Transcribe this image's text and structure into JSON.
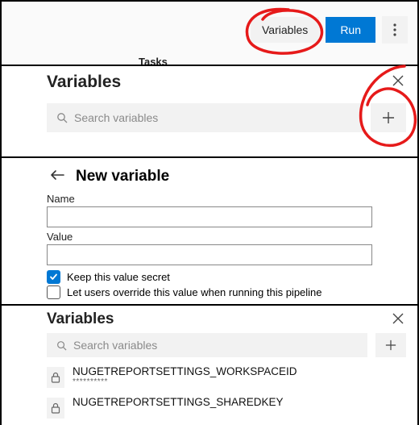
{
  "toolbar": {
    "variables_label": "Variables",
    "run_label": "Run",
    "tasks_hint": "Tasks"
  },
  "panel2": {
    "title": "Variables",
    "search_placeholder": "Search variables"
  },
  "newvar": {
    "title": "New variable",
    "name_label": "Name",
    "value_label": "Value",
    "name_value": "",
    "value_value": "",
    "secret_label": "Keep this value secret",
    "override_label": "Let users override this value when running this pipeline"
  },
  "panel4": {
    "title": "Variables",
    "search_placeholder": "Search variables",
    "vars": [
      {
        "name": "NUGETREPORTSETTINGS_WORKSPACEID",
        "mask": "**********"
      },
      {
        "name": "NUGETREPORTSETTINGS_SHAREDKEY",
        "mask": ""
      }
    ]
  }
}
